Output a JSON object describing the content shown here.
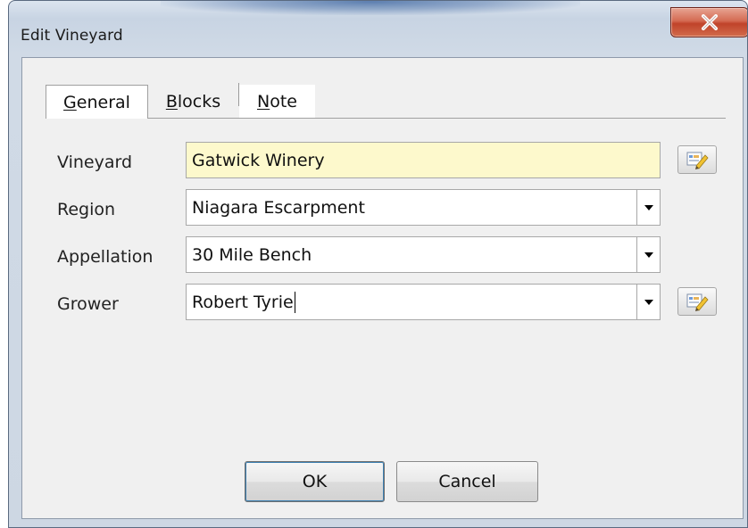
{
  "window": {
    "title": "Edit Vineyard",
    "close_glyph": "X"
  },
  "tabs": [
    {
      "label_pre": "",
      "label_ul": "G",
      "label_post": "eneral",
      "active": true
    },
    {
      "label_pre": "",
      "label_ul": "B",
      "label_post": "locks",
      "active": false
    },
    {
      "label_pre": "",
      "label_ul": "N",
      "label_post": "ote",
      "active": false
    }
  ],
  "form": {
    "vineyard": {
      "label": "Vineyard",
      "value": "Gatwick Winery"
    },
    "region": {
      "label": "Region",
      "value": "Niagara Escarpment"
    },
    "appellation": {
      "label": "Appellation",
      "value": "30 Mile Bench"
    },
    "grower": {
      "label": "Grower",
      "value": "Robert Tyrie"
    }
  },
  "buttons": {
    "ok": "OK",
    "cancel": "Cancel"
  },
  "icons": {
    "edit": "edit-pencil-icon",
    "dropdown": "chevron-down-icon",
    "close": "close-icon"
  },
  "colors": {
    "highlight": "#fdf9cc",
    "close": "#c9472e"
  }
}
